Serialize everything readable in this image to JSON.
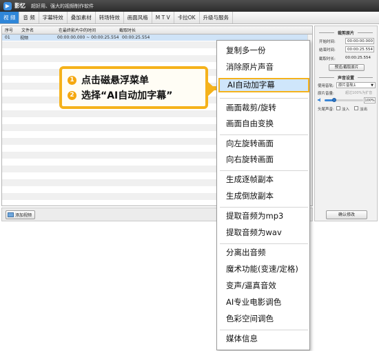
{
  "titlebar": {
    "app_name": "影忆",
    "slogan": "超好用、强大的视频制作软件",
    "logo_icon": "film-logo-icon"
  },
  "menubar": {
    "tabs": [
      {
        "label": "视 频",
        "active": true
      },
      {
        "label": "音 频",
        "active": false
      },
      {
        "label": "字幕特效",
        "active": false
      },
      {
        "label": "叠加素材",
        "active": false
      },
      {
        "label": "转场特效",
        "active": false
      },
      {
        "label": "画面风格",
        "active": false
      },
      {
        "label": "M T V",
        "active": false
      },
      {
        "label": "卡拉OK",
        "active": false
      },
      {
        "label": "升级与服务",
        "active": false
      }
    ]
  },
  "list": {
    "columns": [
      "序号",
      "文件名",
      "在最终影片中的时间",
      "截取时长"
    ],
    "rows": [
      {
        "seq": "01",
        "name": "视频",
        "range": "00:00:00.000 ~ 00:00:25.554",
        "duration": "00:00:25.554"
      }
    ]
  },
  "bottombar": {
    "add_video_label": "添加视频"
  },
  "rightpanel": {
    "clip_title": "裁剪原片",
    "start_label": "开始时间:",
    "start_value": "00:00:00.000",
    "end_label": "结束时间:",
    "end_value": "00:00:25.554",
    "clip_duration_label": "截取时长:",
    "clip_duration_value": "00:00:25.554",
    "preview_btn": "预览/截取原片",
    "sound_title": "声音设置",
    "track_label": "使用音轨:",
    "track_value": "原片音轨1",
    "volume_label": "原片音量:",
    "volume_hint": "超过100%为扩音",
    "volume_value": "100%",
    "volume_level": 0.25,
    "fade_label": "头尾声音:",
    "fade_in_label": "淡入",
    "fade_out_label": "淡出",
    "confirm_btn": "确认修改"
  },
  "callout": {
    "step1_num": "1",
    "step1_text": "点击磁悬浮菜单",
    "step2_num": "2",
    "step2_text": "选择“AI自动加字幕”",
    "accent_color": "#f5b21b"
  },
  "context_menu": {
    "items": [
      "复制多一份",
      "消除原片声音",
      "AI自动加字幕",
      "画面裁剪/旋转",
      "画面自由变换",
      "向左旋转画面",
      "向右旋转画面",
      "生成逐帧副本",
      "生成倒放副本",
      "提取音频为mp3",
      "提取音频为wav",
      "分离出音频",
      "魔术功能(变速/定格)",
      "变声/逼真音效",
      "AI专业电影调色",
      "色彩空间调色",
      "媒体信息"
    ],
    "highlighted": "AI自动加字幕"
  }
}
